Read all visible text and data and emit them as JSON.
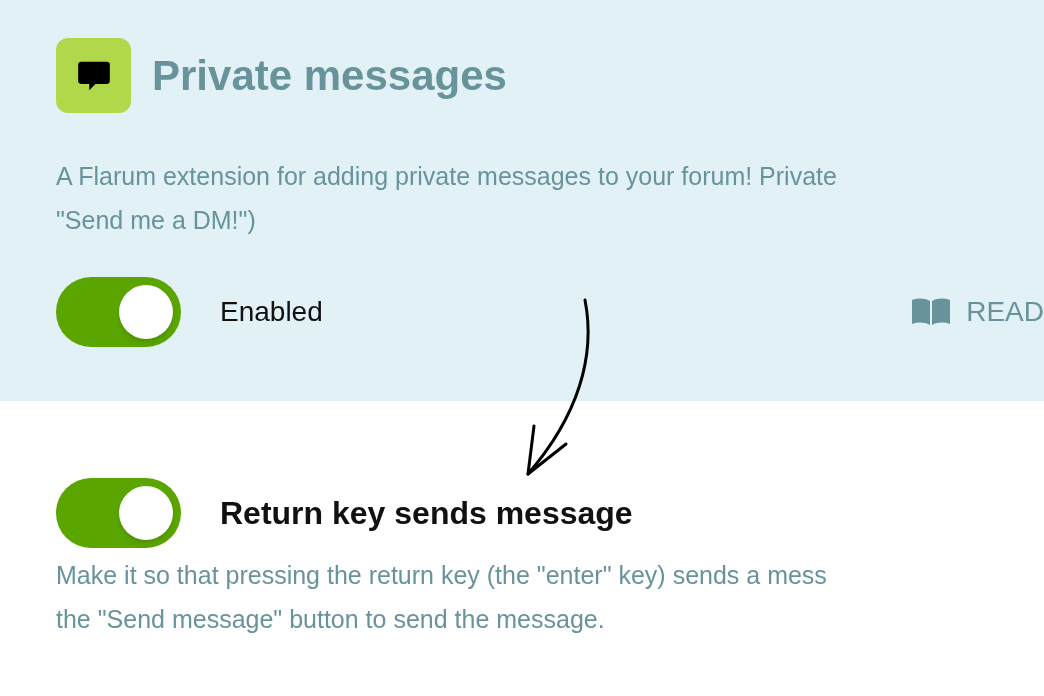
{
  "extension": {
    "title": "Private messages",
    "description": [
      "A Flarum extension for adding private messages to your forum! Private",
      "\"Send me a DM!\")"
    ],
    "toggle": {
      "label": "Enabled",
      "on": true
    },
    "link": "READ"
  },
  "setting": {
    "title": "Return key sends message",
    "on": true,
    "description": [
      "Make it so that pressing the return key (the \"enter\" key) sends a mess",
      "the \"Send message\" button to send the message."
    ]
  }
}
